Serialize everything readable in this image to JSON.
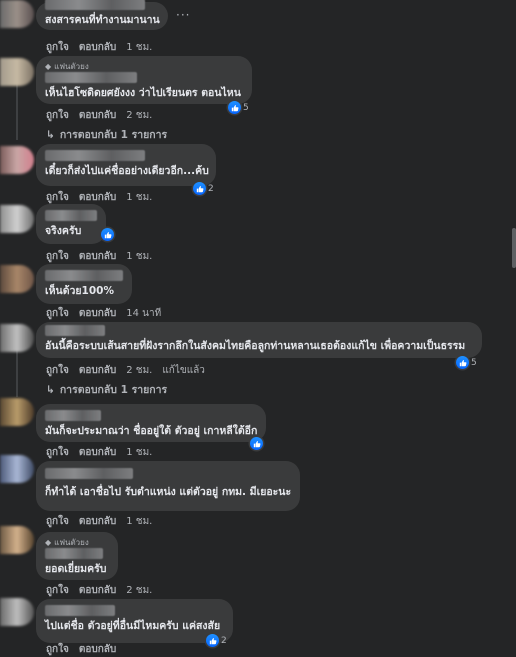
{
  "comments": [
    {
      "badge": "",
      "text": "สงสารคนที่ทำงานมานาน",
      "like": "ถูกใจ",
      "reply": "ตอบกลับ",
      "time": "1 ชม.",
      "reactions": ""
    },
    {
      "badge": "แฟนตัวยง",
      "text": "เห็นไฮโซดิดยศยังงง ว่าไปเรียนตร ตอนไหน",
      "like": "ถูกใจ",
      "reply": "ตอบกลับ",
      "time": "2 ชม.",
      "reactions": "5"
    },
    {
      "badge": "",
      "text": "เดี๋ยวก็ส่งไปแค่ชื่ออย่างเดียวอีก...ค้บ",
      "like": "ถูกใจ",
      "reply": "ตอบกลับ",
      "time": "1 ชม.",
      "reactions": "2"
    },
    {
      "badge": "",
      "text": "จริงครับ",
      "like": "ถูกใจ",
      "reply": "ตอบกลับ",
      "time": "1 ชม.",
      "reactions": ""
    },
    {
      "badge": "",
      "text": "เห็นด้วย100%",
      "like": "ถูกใจ",
      "reply": "ตอบกลับ",
      "time": "14 นาที",
      "reactions": ""
    },
    {
      "badge": "",
      "text": "อันนี้คือระบบเส้นสายที่ฝังรากลึกในสังคมไทยคือลูกท่านหลานเธอต้องแก้ไข เพื่อความเป็นธรรม",
      "like": "ถูกใจ",
      "reply": "ตอบกลับ",
      "time": "2 ชม.",
      "edited": "แก้ไขแล้ว",
      "reactions": "5"
    },
    {
      "badge": "",
      "text": "มันก็จะประมาณว่า ชื่ออยู่ใต้ ตัวอยู่ เกาหลีใต้อีก",
      "like": "ถูกใจ",
      "reply": "ตอบกลับ",
      "time": "1 ชม.",
      "reactions": ""
    },
    {
      "badge": "",
      "text": "ก็ทำได้ เอาชื่อไป รับตำแหน่ง แต่ตัวอยู่ กทม. มีเยอะนะ",
      "like": "ถูกใจ",
      "reply": "ตอบกลับ",
      "time": "1 ชม.",
      "reactions": ""
    },
    {
      "badge": "แฟนตัวยง",
      "text": "ยอดเยี่ยมครับ",
      "like": "ถูกใจ",
      "reply": "ตอบกลับ",
      "time": "2 ชม.",
      "reactions": ""
    },
    {
      "badge": "",
      "text": "ไปแต่ชื่อ ตัวอยู่ที่อื่นมีไหมครับ แค่สงสัย",
      "like": "ถูกใจ",
      "reply": "ตอบกลับ",
      "time": "",
      "reactions": "2"
    }
  ],
  "replies_link_1": "การตอบกลับ 1 รายการ",
  "replies_link_2": "การตอบกลับ 1 รายการ",
  "more_menu": "···",
  "icons": {
    "like": "like-icon",
    "reply_arrow": "reply-arrow-icon",
    "more": "more-options-icon",
    "badge": "diamond-icon"
  },
  "colors": {
    "background": "#242526",
    "bubble": "#3a3b3c",
    "like_blue": "#0866ff",
    "text": "#e4e6eb",
    "muted": "#b0b3b8"
  }
}
